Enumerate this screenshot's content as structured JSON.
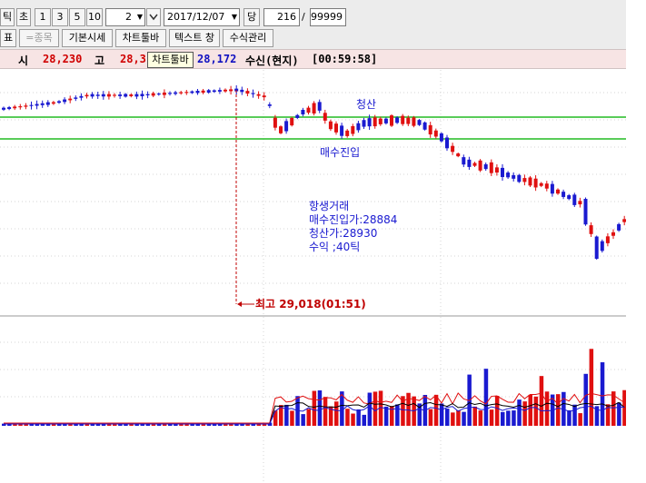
{
  "toolbar": {
    "tick_label": "틱",
    "sec_label": "초",
    "period_buttons": [
      "1",
      "3",
      "5",
      "10"
    ],
    "interval_value": "2",
    "date_value": "2017/12/07",
    "dang_label": "당",
    "count_value": "216",
    "separator": "/",
    "max_value": "99999"
  },
  "toolbar2": {
    "pyo_label": "표",
    "jongmok_label": "=종목",
    "basic_quote_label": "기본시세",
    "chart_toolbar_label": "차트툴바",
    "text_window_label": "텍스트 창",
    "formula_label": "수식관리"
  },
  "tooltip": "차트툴바",
  "info": {
    "si_label": "시",
    "open_value": "28,230",
    "go_label": "고",
    "high_value": "28,3",
    "last_value": "28,172",
    "status": "수신(현지)",
    "time": "[00:59:58]"
  },
  "annotations": {
    "exit_label": "청산",
    "entry_label": "매수진입",
    "trade_title": "항생거래",
    "entry_price": "매수진입가:28884",
    "exit_price": "청산가:28930",
    "profit": "수익 ;40틱",
    "high_note": "최고 29,018(01:51)"
  },
  "colors": {
    "up": "#e01010",
    "down": "#1a1ad0",
    "support_line": "#22bb22",
    "info_text_red": "#d00000",
    "info_text_blue": "#1010c0"
  },
  "chart_data": {
    "type": "candlestick",
    "horizontal_lines": [
      "exit",
      "entry"
    ],
    "volume_panel": true
  }
}
